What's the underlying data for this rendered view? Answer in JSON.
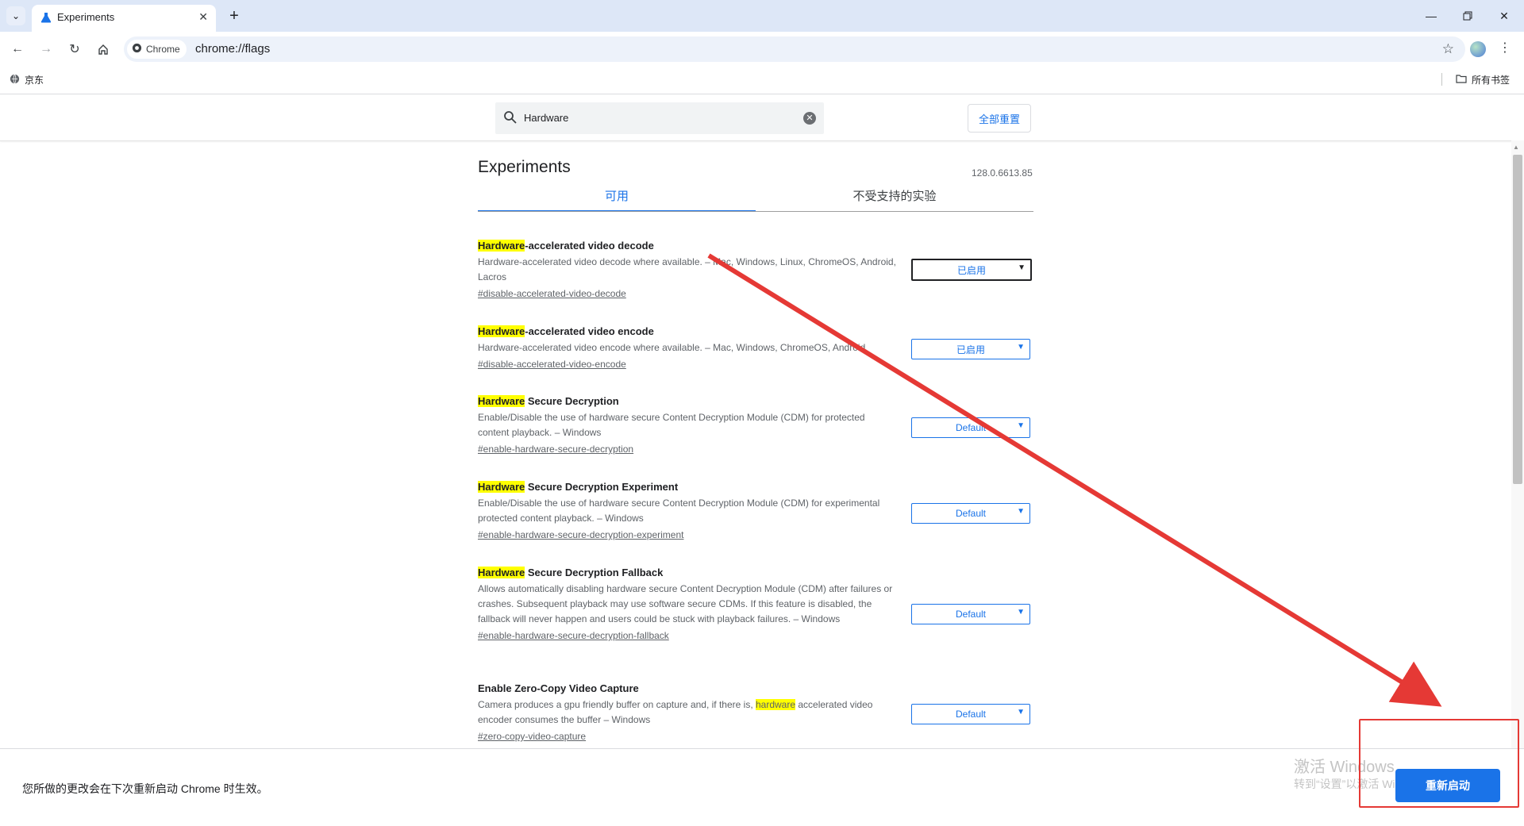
{
  "browser": {
    "tab_title": "Experiments",
    "url_chip": "Chrome",
    "url": "chrome://flags",
    "bookmark_item": "京东",
    "bookmarks_all": "所有书签"
  },
  "flags_header": {
    "search_value": "Hardware",
    "reset_label": "全部重置"
  },
  "page": {
    "title": "Experiments",
    "version": "128.0.6613.85",
    "tab_available": "可用",
    "tab_unsupported": "不受支持的实验"
  },
  "experiments": [
    {
      "name_hl": "Hardware",
      "name_rest": "-accelerated video decode",
      "desc": "Hardware-accelerated video decode where available. – Mac, Windows, Linux, ChromeOS, Android, Lacros",
      "link": "#disable-accelerated-video-decode",
      "select_value": "已启用"
    },
    {
      "name_hl": "Hardware",
      "name_rest": "-accelerated video encode",
      "desc": "Hardware-accelerated video encode where available. – Mac, Windows, ChromeOS, Android",
      "link": "#disable-accelerated-video-encode",
      "select_value": "已启用"
    },
    {
      "name_hl": "Hardware",
      "name_rest": " Secure Decryption",
      "desc": "Enable/Disable the use of hardware secure Content Decryption Module (CDM) for protected content playback. – Windows",
      "link": "#enable-hardware-secure-decryption",
      "select_value": "Default"
    },
    {
      "name_hl": "Hardware",
      "name_rest": " Secure Decryption Experiment",
      "desc": "Enable/Disable the use of hardware secure Content Decryption Module (CDM) for experimental protected content playback. – Windows",
      "link": "#enable-hardware-secure-decryption-experiment",
      "select_value": "Default"
    },
    {
      "name_hl": "Hardware",
      "name_rest": " Secure Decryption Fallback",
      "desc": "Allows automatically disabling hardware secure Content Decryption Module (CDM) after failures or crashes. Subsequent playback may use software secure CDMs. If this feature is disabled, the fallback will never happen and users could be stuck with playback failures. – Windows",
      "link": "#enable-hardware-secure-decryption-fallback",
      "select_value": "Default"
    },
    {
      "name": "Enable Zero-Copy Video Capture",
      "desc_pre": "Camera produces a gpu friendly buffer on capture and, if there is, ",
      "desc_hl": "hardware",
      "desc_post": " accelerated video encoder consumes the buffer – Windows",
      "link": "#zero-copy-video-capture",
      "select_value": "Default"
    }
  ],
  "bottom": {
    "message": "您所做的更改会在下次重新启动 Chrome 时生效。",
    "restart_label": "重新启动",
    "watermark_line1": "激活 Windows",
    "watermark_line2": "转到“设置”以激活 Windows。"
  },
  "colors": {
    "accent": "#1a73e8",
    "highlight": "#ffff00",
    "annotation": "#e53935",
    "tabstrip": "#dde7f7"
  }
}
